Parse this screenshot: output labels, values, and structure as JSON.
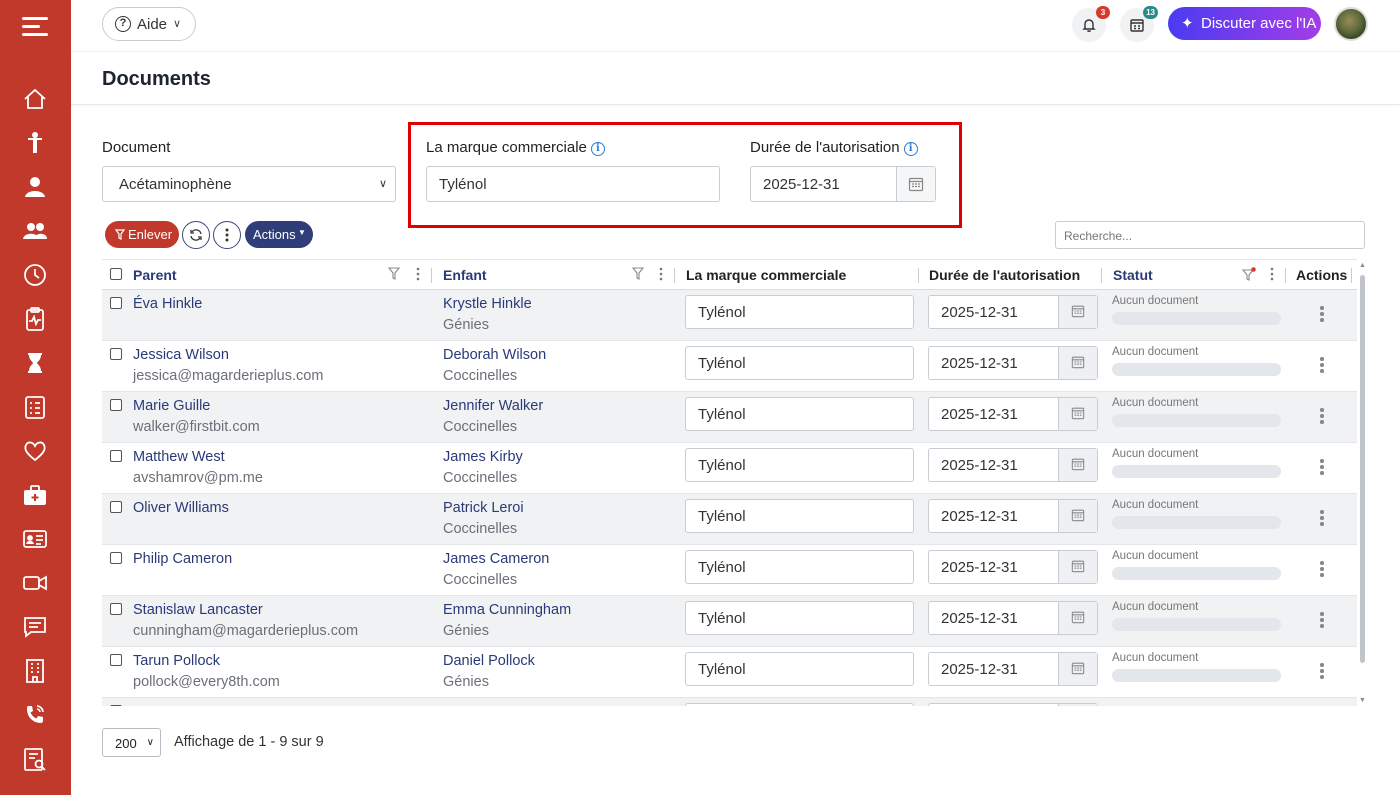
{
  "topbar": {
    "help_label": "Aide",
    "notifications_count": "3",
    "calendar_count": "13",
    "ai_button_label": "Discuter avec l'IA"
  },
  "page": {
    "title": "Documents"
  },
  "form": {
    "document_label": "Document",
    "document_value": "Acétaminophène",
    "brand_label": "La marque commerciale",
    "brand_value": "Tylénol",
    "duration_label": "Durée de l'autorisation",
    "duration_value": "2025-12-31"
  },
  "toolbar": {
    "remove_label": "Enlever",
    "actions_label": "Actions",
    "search_placeholder": "Recherche..."
  },
  "grid": {
    "headers": {
      "parent": "Parent",
      "child": "Enfant",
      "brand": "La marque commerciale",
      "duration": "Durée de l'autorisation",
      "status": "Statut",
      "actions": "Actions"
    },
    "rows": [
      {
        "parent": "Éva Hinkle",
        "parent_sub": "",
        "child": "Krystle Hinkle",
        "child_sub": "Génies",
        "brand": "Tylénol",
        "date": "2025-12-31",
        "status": "Aucun document"
      },
      {
        "parent": "Jessica Wilson",
        "parent_sub": "jessica@magarderieplus.com",
        "child": "Deborah Wilson",
        "child_sub": "Coccinelles",
        "brand": "Tylénol",
        "date": "2025-12-31",
        "status": "Aucun document"
      },
      {
        "parent": "Marie Guille",
        "parent_sub": "walker@firstbit.com",
        "child": "Jennifer Walker",
        "child_sub": "Coccinelles",
        "brand": "Tylénol",
        "date": "2025-12-31",
        "status": "Aucun document"
      },
      {
        "parent": "Matthew West",
        "parent_sub": "avshamrov@pm.me",
        "child": "James Kirby",
        "child_sub": "Coccinelles",
        "brand": "Tylénol",
        "date": "2025-12-31",
        "status": "Aucun document"
      },
      {
        "parent": "Oliver Williams",
        "parent_sub": "",
        "child": "Patrick Leroi",
        "child_sub": "Coccinelles",
        "brand": "Tylénol",
        "date": "2025-12-31",
        "status": "Aucun document"
      },
      {
        "parent": "Philip Cameron",
        "parent_sub": "",
        "child": "James Cameron",
        "child_sub": "Coccinelles",
        "brand": "Tylénol",
        "date": "2025-12-31",
        "status": "Aucun document"
      },
      {
        "parent": "Stanislaw Lancaster",
        "parent_sub": "cunningham@magarderieplus.com",
        "child": "Emma Cunningham",
        "child_sub": "Génies",
        "brand": "Tylénol",
        "date": "2025-12-31",
        "status": "Aucun document"
      },
      {
        "parent": "Tarun Pollock",
        "parent_sub": "pollock@every8th.com",
        "child": "Daniel Pollock",
        "child_sub": "Génies",
        "brand": "Tylénol",
        "date": "2025-12-31",
        "status": "Aucun document"
      }
    ]
  },
  "footer": {
    "page_size": "200",
    "summary": "Affichage de 1 - 9 sur 9"
  },
  "colors": {
    "sidebar": "#c0392b",
    "primary_navy": "#2f3d78",
    "danger": "#c0392b",
    "highlight_frame": "#e00000",
    "ai_gradient_start": "#4a3cf0",
    "ai_gradient_end": "#a43ce8"
  }
}
